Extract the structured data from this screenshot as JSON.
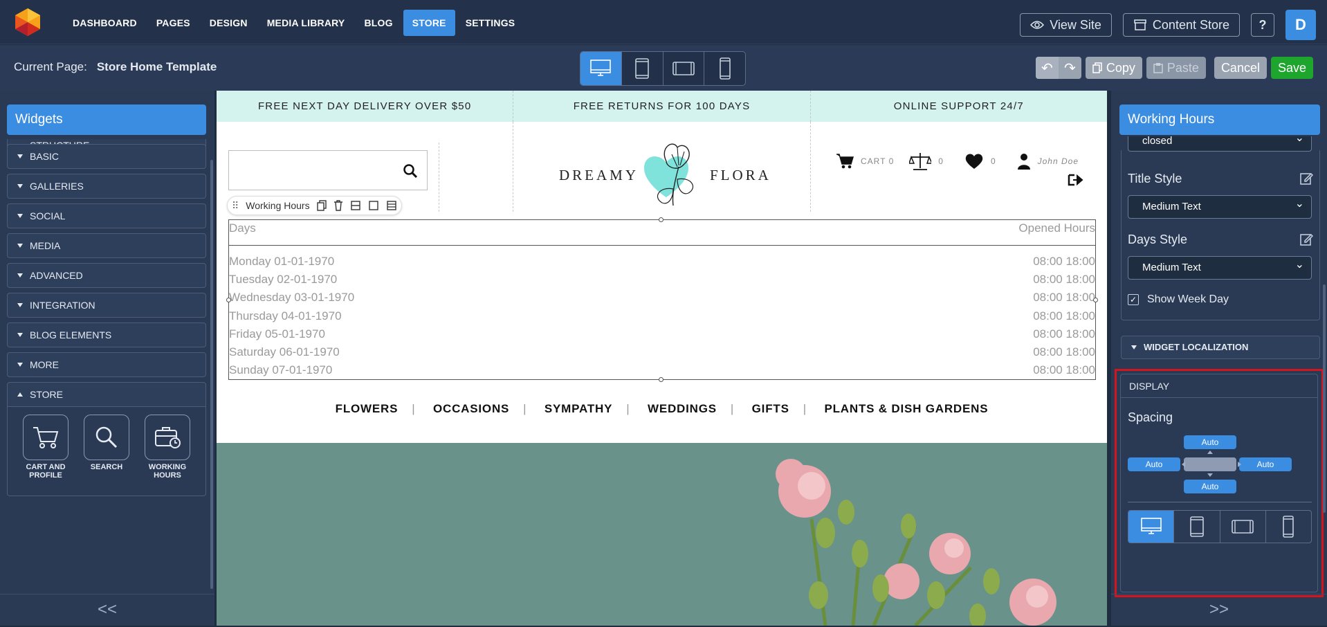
{
  "nav": {
    "items": [
      "DASHBOARD",
      "PAGES",
      "DESIGN",
      "MEDIA LIBRARY",
      "BLOG",
      "STORE",
      "SETTINGS"
    ],
    "active": "STORE"
  },
  "topright": {
    "view_site": "View Site",
    "content_store": "Content Store",
    "help": "?",
    "avatar": "D"
  },
  "subbar": {
    "current_label": "Current Page:",
    "current_page": "Store Home Template",
    "copy": "Copy",
    "paste": "Paste",
    "cancel": "Cancel",
    "save": "Save"
  },
  "left": {
    "title": "Widgets",
    "categories": [
      "STRUCTURE",
      "BASIC",
      "GALLERIES",
      "SOCIAL",
      "MEDIA",
      "ADVANCED",
      "INTEGRATION",
      "BLOG ELEMENTS",
      "MORE",
      "STORE"
    ],
    "store_widgets": [
      "CART AND PROFILE",
      "SEARCH",
      "WORKING HOURS"
    ],
    "collapse": "<<"
  },
  "canvas": {
    "promo": [
      "FREE NEXT DAY DELIVERY OVER $50",
      "FREE RETURNS FOR 100 DAYS",
      "ONLINE SUPPORT 24/7"
    ],
    "brand_left": "DREAMY",
    "brand_right": "FLORA",
    "cart_label": "CART 0",
    "compare_count": "0",
    "wish_count": "0",
    "user_name": "John Doe",
    "toolbar_label": "Working Hours",
    "hours_head_left": "Days",
    "hours_head_right": "Opened Hours",
    "hours": [
      {
        "day": "Monday 01-01-1970",
        "time": "08:00 18:00"
      },
      {
        "day": "Tuesday 02-01-1970",
        "time": "08:00 18:00"
      },
      {
        "day": "Wednesday 03-01-1970",
        "time": "08:00 18:00"
      },
      {
        "day": "Thursday 04-01-1970",
        "time": "08:00 18:00"
      },
      {
        "day": "Friday 05-01-1970",
        "time": "08:00 18:00"
      },
      {
        "day": "Saturday 06-01-1970",
        "time": "08:00 18:00"
      },
      {
        "day": "Sunday 07-01-1970",
        "time": "08:00 18:00"
      }
    ],
    "menu": [
      "FLOWERS",
      "OCCASIONS",
      "SYMPATHY",
      "WEDDINGS",
      "GIFTS",
      "PLANTS & DISH GARDENS"
    ]
  },
  "right": {
    "title": "Working Hours",
    "closed_value": "closed",
    "title_style_label": "Title Style",
    "title_style_value": "Medium Text",
    "days_style_label": "Days Style",
    "days_style_value": "Medium Text",
    "show_week_day": "Show Week Day",
    "localization": "WIDGET LOCALIZATION",
    "display": "DISPLAY",
    "spacing": "Spacing",
    "spacing_top": "Auto",
    "spacing_left": "Auto",
    "spacing_right": "Auto",
    "spacing_bottom": "Auto",
    "expand": ">>"
  },
  "colors": {
    "accent": "#3a8de0",
    "save": "#1da52e",
    "highlight": "#d4151c",
    "promo_bg": "#d4f3ef"
  }
}
